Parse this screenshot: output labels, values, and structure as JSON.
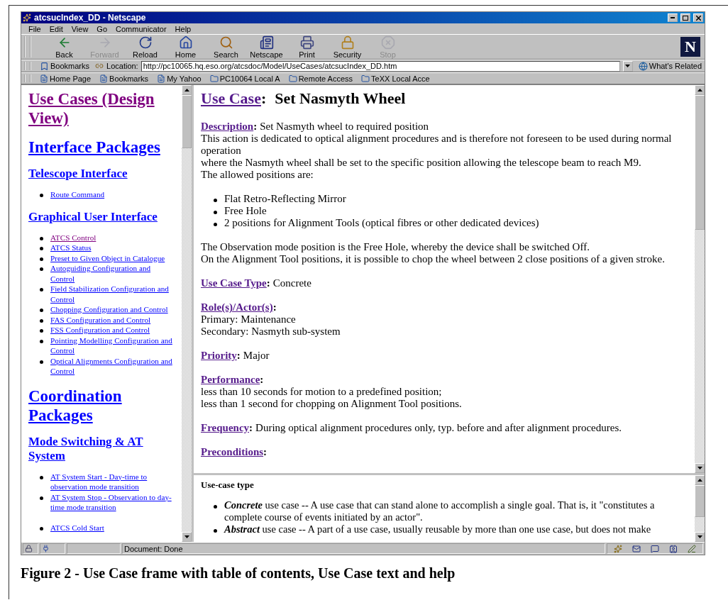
{
  "window": {
    "title": "atcsucIndex_DD - Netscape"
  },
  "menu": [
    "File",
    "Edit",
    "View",
    "Go",
    "Communicator",
    "Help"
  ],
  "toolbar": [
    {
      "label": "Back",
      "disabled": false
    },
    {
      "label": "Forward",
      "disabled": true
    },
    {
      "label": "Reload",
      "disabled": false
    },
    {
      "label": "Home",
      "disabled": false
    },
    {
      "label": "Search",
      "disabled": false
    },
    {
      "label": "Netscape",
      "disabled": false
    },
    {
      "label": "Print",
      "disabled": false
    },
    {
      "label": "Security",
      "disabled": false
    },
    {
      "label": "Stop",
      "disabled": true
    }
  ],
  "logo": "N",
  "location_bar": {
    "bookmarks": "Bookmarks",
    "label": "Location:",
    "url": "http://pc10065.hq.eso.org/atcsdoc/Model/UseCases/atcsucIndex_DD.htm",
    "related": "What's Related"
  },
  "personal_toolbar": [
    {
      "label": "Home Page",
      "kind": "page"
    },
    {
      "label": "Bookmarks",
      "kind": "page"
    },
    {
      "label": "My Yahoo",
      "kind": "page"
    },
    {
      "label": "PC10064 Local A",
      "kind": "folder"
    },
    {
      "label": "Remote Access",
      "kind": "folder"
    },
    {
      "label": "TeXX Local Acce",
      "kind": "folder"
    }
  ],
  "toc": [
    {
      "kind": "h1",
      "text": "Use Cases (Design View)",
      "visited": true
    },
    {
      "kind": "h1",
      "text": "Interface Packages",
      "visited": false
    },
    {
      "kind": "h2",
      "text": "Telescope Interface",
      "visited": false
    },
    {
      "kind": "list",
      "items": [
        {
          "text": "Route Command",
          "visited": false
        }
      ]
    },
    {
      "kind": "h2",
      "text": "Graphical User Interface",
      "visited": false
    },
    {
      "kind": "list",
      "items": [
        {
          "text": "ATCS Control",
          "visited": true
        },
        {
          "text": "ATCS Status",
          "visited": false
        },
        {
          "text": "Preset to Given Object in Catalogue",
          "visited": false
        },
        {
          "text": "Autoguiding Configuration and Control",
          "visited": false
        },
        {
          "text": "Field Stabilization Configuration and Control",
          "visited": false
        },
        {
          "text": "Chopping Configuration and Control",
          "visited": false
        },
        {
          "text": "FAS Configuration and Control",
          "visited": false
        },
        {
          "text": "FSS Configuration and Control",
          "visited": false
        },
        {
          "text": "Pointing Modelling Configuration and Control",
          "visited": false
        },
        {
          "text": "Optical Alignments Configuration and Control",
          "visited": false
        }
      ]
    },
    {
      "kind": "h1",
      "text": "Coordination Packages",
      "visited": false
    },
    {
      "kind": "h2",
      "text": "Mode Switching & AT System",
      "visited": false
    },
    {
      "kind": "list",
      "items": [
        {
          "text": "AT System Start - Day-time to observation mode transition",
          "visited": false
        },
        {
          "text": "AT System Stop - Observation to day-time mode transition",
          "visited": false
        }
      ]
    },
    {
      "kind": "list",
      "items": [
        {
          "text": "ATCS Cold Start",
          "visited": false
        }
      ]
    }
  ],
  "document": {
    "title_link": "Use Case",
    "suffix": ":",
    "title": "Set Nasmyth Wheel",
    "blocks": [
      {
        "kind": "field",
        "label": "Description",
        "suffix": ":",
        "value": "Set Nasmyth wheel to required position",
        "lines": [
          "This action is dedicated to optical alignment procedures and is therefore not foreseen to be used during normal",
          "operation",
          "where the Nasmyth wheel shall be set to the specific position allowing the telescope beam to reach M9.",
          "The allowed positions are:"
        ]
      },
      {
        "kind": "list",
        "items": [
          "Flat Retro-Reflecting Mirror",
          "Free Hole",
          "2 positions for Alignment Tools (optical fibres or other dedicated devices)"
        ]
      },
      {
        "kind": "paragraph",
        "lines": [
          "The Observation mode position is the Free Hole, whereby the device shall be switched Off.",
          "On the Alignment Tool positions, it is possible to chop the wheel between 2 close positions of a given stroke."
        ]
      },
      {
        "kind": "field",
        "label": "Use Case Type",
        "suffix": ":",
        "value": "Concrete"
      },
      {
        "kind": "field",
        "label": "Role(s)/Actor(s)",
        "suffix": ":",
        "lines": [
          "Primary: Maintenance",
          "Secondary: Nasmyth sub-system"
        ]
      },
      {
        "kind": "field",
        "label": "Priority",
        "suffix": ":",
        "value": "Major"
      },
      {
        "kind": "field",
        "label": "Performance",
        "suffix": ":",
        "lines": [
          "less than 10 seconds for motion to a predefined position;",
          "less than 1 second for chopping on Alignment Tool positions."
        ]
      },
      {
        "kind": "field",
        "label": "Frequency",
        "suffix": ":",
        "value": "During optical alignment procedures only, typ. before and after alignment procedures."
      },
      {
        "kind": "field",
        "label": "Preconditions",
        "suffix": ":"
      }
    ]
  },
  "help": {
    "heading": "Use-case type",
    "items": [
      {
        "term": "Concrete",
        "text": " use case -- A use case that can stand alone to accomplish a single goal. That is, it \"constitutes a complete course of events initiated by an actor\"."
      },
      {
        "term": "Abstract",
        "text": " use case -- A part of a use case, usually reusable by more than one use case, but does not make"
      }
    ]
  },
  "status_bar": {
    "text": "Document: Done"
  },
  "caption": "Figure 2 - Use Case frame with table of contents, Use Case text and help"
}
